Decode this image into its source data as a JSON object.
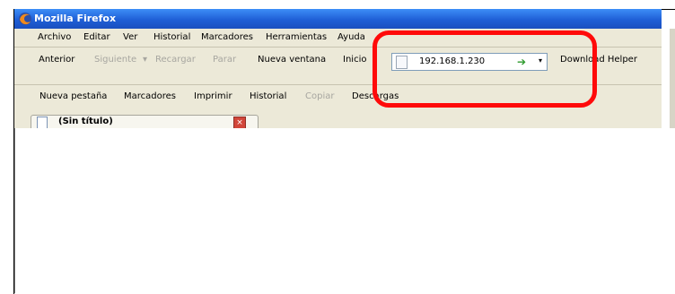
{
  "window": {
    "title": "Mozilla Firefox"
  },
  "menu": [
    "Archivo",
    "Editar",
    "Ver",
    "Historial",
    "Marcadores",
    "Herramientas",
    "Ayuda"
  ],
  "nav": {
    "back": "Anterior",
    "forward": "Siguiente",
    "reload": "Recargar",
    "stop": "Parar",
    "new_window": "Nueva ventana",
    "home": "Inicio",
    "url": "192.168.1.230",
    "download_helper": "Download Helper"
  },
  "bookmarks_bar": [
    "Nueva pestaña",
    "Marcadores",
    "Imprimir",
    "Historial",
    "Copiar",
    "Descargas"
  ],
  "tab": {
    "title": "(Sin título)",
    "close": "×"
  },
  "colors": {
    "titlebar": "#1f5fd6",
    "highlight": "#ff0a0a",
    "go_arrow": "#2e9a2e"
  },
  "icons": {
    "app": "firefox-logo-icon",
    "go": "go-arrow-icon",
    "page": "page-icon",
    "close": "close-tab-icon"
  }
}
